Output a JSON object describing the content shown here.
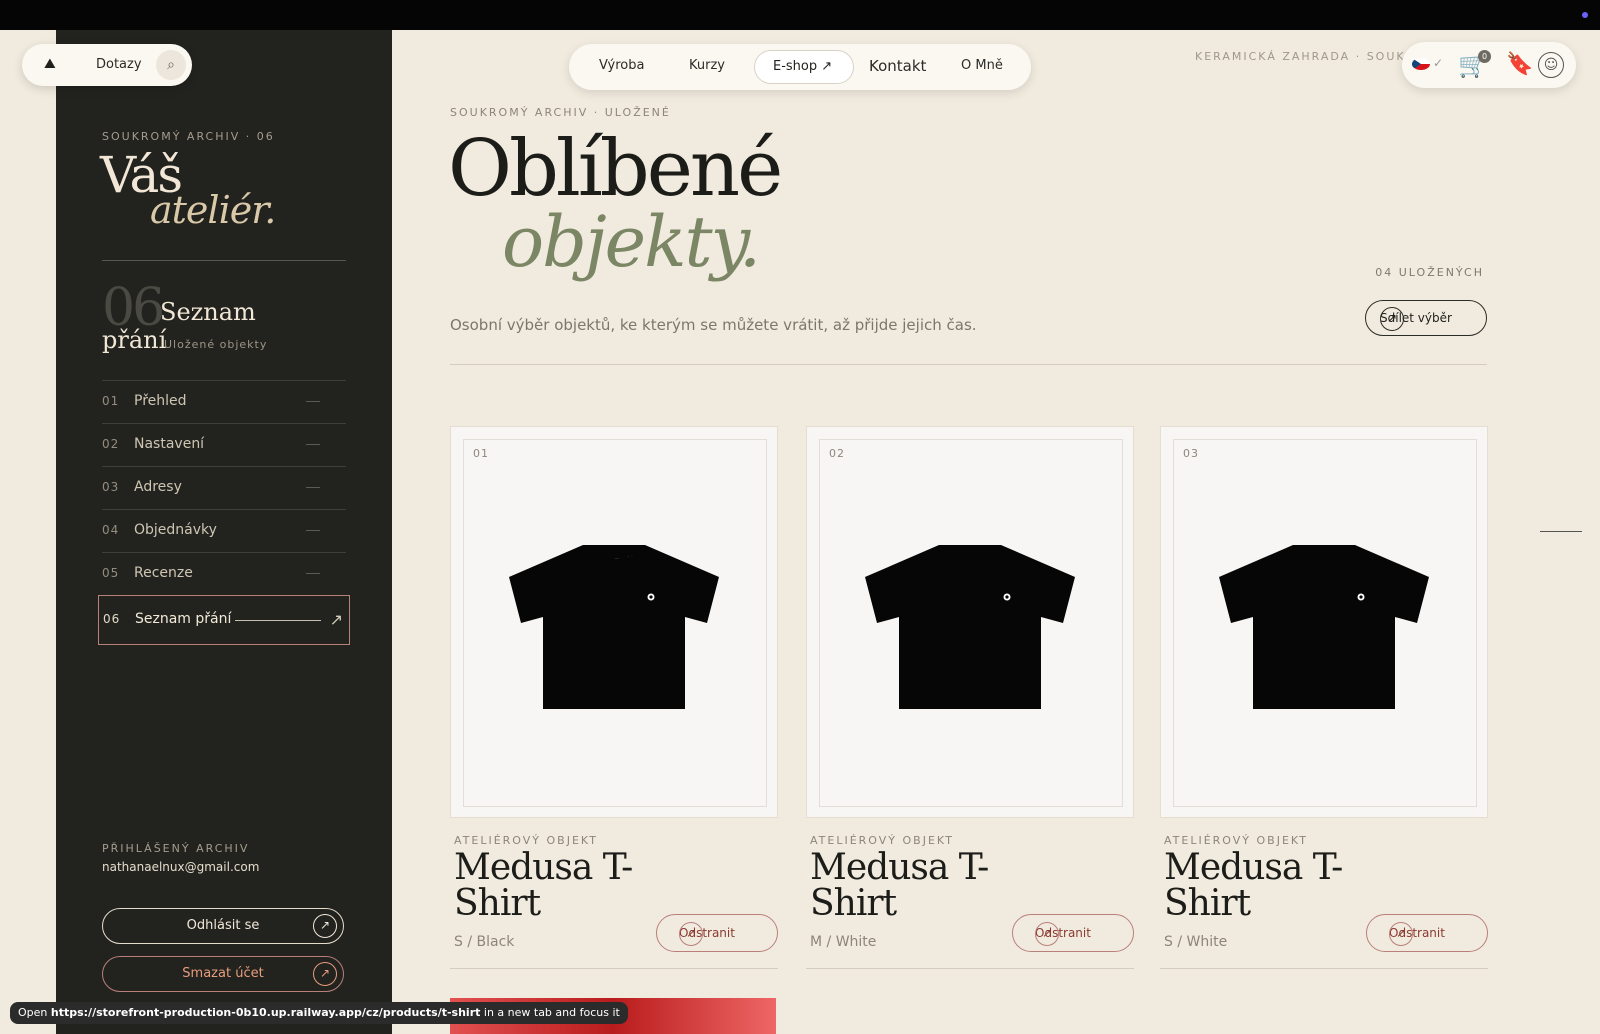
{
  "header": {
    "left_pill_label": "Dotazy",
    "nav": [
      "Výroba",
      "Kurzy",
      "E-shop ↗",
      "Kontakt",
      "O Mně"
    ],
    "breadcrumb_top": "KERAMICKÁ ZAHRADA · SOUKRO",
    "cart_count": "0"
  },
  "sidebar": {
    "eyebrow": "SOUKROMÝ ARCHIV · 06",
    "title_line1": "Váš",
    "title_line2": "ateliér.",
    "section_number": "06",
    "section_title_line1": "Seznam",
    "section_title_line2": "přání",
    "section_subtitle": "Uložené objekty",
    "items": [
      {
        "num": "01",
        "label": "Přehled"
      },
      {
        "num": "02",
        "label": "Nastavení"
      },
      {
        "num": "03",
        "label": "Adresy"
      },
      {
        "num": "04",
        "label": "Objednávky"
      },
      {
        "num": "05",
        "label": "Recenze"
      },
      {
        "num": "06",
        "label": "Seznam přání"
      }
    ],
    "account_label": "PŘIHLÁŠENÝ ARCHIV",
    "account_email": "nathanaelnux@gmail.com",
    "logout_label": "Odhlásit se",
    "delete_label": "Smazat účet"
  },
  "main": {
    "eyebrow": "SOUKROMÝ ARCHIV · ULOŽENÉ",
    "title_line1": "Oblíbené",
    "title_line2": "objekty.",
    "saved_count": "04 ULOŽENÝCH",
    "lead": "Osobní výběr objektů, ke kterým se můžete vrátit, až přijde jejich čas.",
    "share_label": "Sdílet výběr",
    "cards": [
      {
        "idx": "01",
        "category": "ATELIÉROVÝ OBJEKT",
        "name": "Medusa T-Shirt",
        "variant": "S / Black",
        "remove": "Odstranit"
      },
      {
        "idx": "02",
        "category": "ATELIÉROVÝ OBJEKT",
        "name": "Medusa T-Shirt",
        "variant": "M / White",
        "remove": "Odstranit"
      },
      {
        "idx": "03",
        "category": "ATELIÉROVÝ OBJEKT",
        "name": "Medusa T-Shirt",
        "variant": "S / White",
        "remove": "Odstranit"
      }
    ]
  },
  "tooltip": {
    "prefix": "Open ",
    "url": "https://storefront-production-0b10.up.railway.app/cz/products/t-shirt",
    "suffix": " in a new tab and focus it"
  },
  "icons": {
    "logo": "mountain-icon",
    "search": "search-icon",
    "cart": "cart-icon",
    "bookmark": "bookmark-icon",
    "user": "user-icon",
    "arrow": "arrow-up-right-icon"
  },
  "colors": {
    "sidebar_bg": "#22231f",
    "page_bg": "#f1ebdf",
    "accent_olive": "#7b8664",
    "accent_rose": "#b9807a"
  }
}
